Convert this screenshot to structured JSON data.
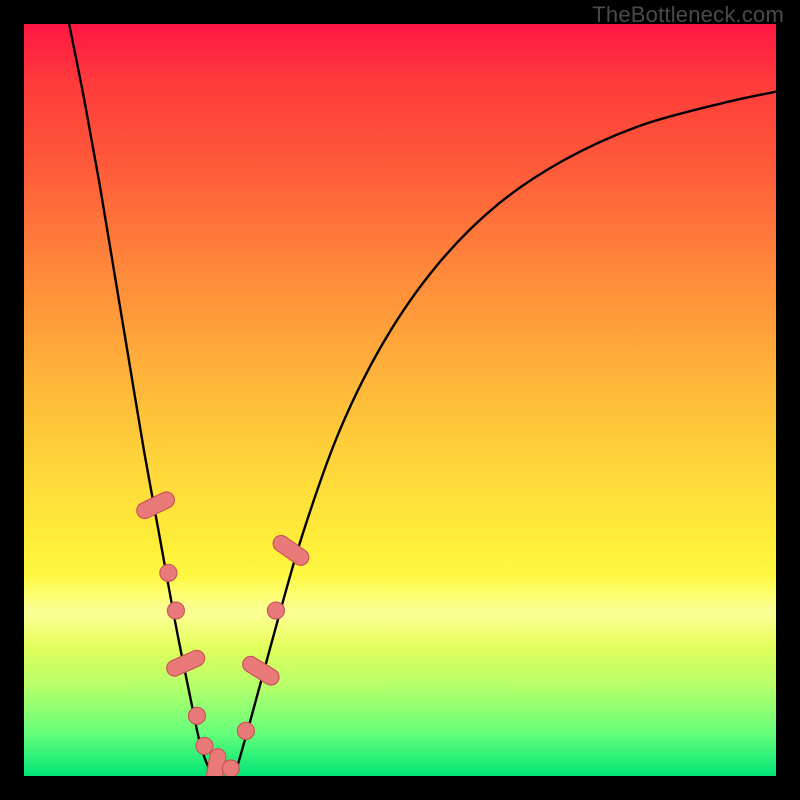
{
  "watermark": {
    "text": "TheBottleneck.com"
  },
  "colors": {
    "frame": "#000000",
    "curve_stroke": "#000000",
    "bead_fill": "#ea7a7a",
    "bead_stroke": "#c85656"
  },
  "chart_data": {
    "type": "line",
    "title": "",
    "xlabel": "",
    "ylabel": "",
    "xlim": [
      0,
      100
    ],
    "ylim": [
      0,
      100
    ],
    "grid": false,
    "legend": false,
    "series": [
      {
        "name": "left-branch",
        "x": [
          6,
          8,
          10,
          12,
          14,
          16,
          18,
          20,
          22,
          23.5,
          25
        ],
        "y": [
          100,
          90,
          79,
          67,
          55,
          43,
          32,
          21,
          11,
          4,
          0
        ]
      },
      {
        "name": "right-branch",
        "x": [
          28,
          30,
          33,
          37,
          42,
          48,
          55,
          63,
          72,
          82,
          93,
          100
        ],
        "y": [
          0,
          7,
          18,
          32,
          46,
          58,
          68,
          76,
          82,
          86.5,
          89.5,
          91
        ]
      }
    ],
    "markers": {
      "name": "beads",
      "points": [
        {
          "x": 17.5,
          "y": 36,
          "kind": "pill",
          "angle": 64
        },
        {
          "x": 19.2,
          "y": 27,
          "kind": "ball"
        },
        {
          "x": 20.2,
          "y": 22,
          "kind": "ball"
        },
        {
          "x": 21.5,
          "y": 15,
          "kind": "pill",
          "angle": 66
        },
        {
          "x": 23.0,
          "y": 8,
          "kind": "ball"
        },
        {
          "x": 24.0,
          "y": 4,
          "kind": "ball"
        },
        {
          "x": 25.5,
          "y": 1,
          "kind": "pill",
          "angle": 10
        },
        {
          "x": 27.5,
          "y": 1,
          "kind": "ball"
        },
        {
          "x": 29.5,
          "y": 6,
          "kind": "ball"
        },
        {
          "x": 31.5,
          "y": 14,
          "kind": "pill",
          "angle": -58
        },
        {
          "x": 33.5,
          "y": 22,
          "kind": "ball"
        },
        {
          "x": 35.5,
          "y": 30,
          "kind": "pill",
          "angle": -55
        }
      ]
    }
  }
}
